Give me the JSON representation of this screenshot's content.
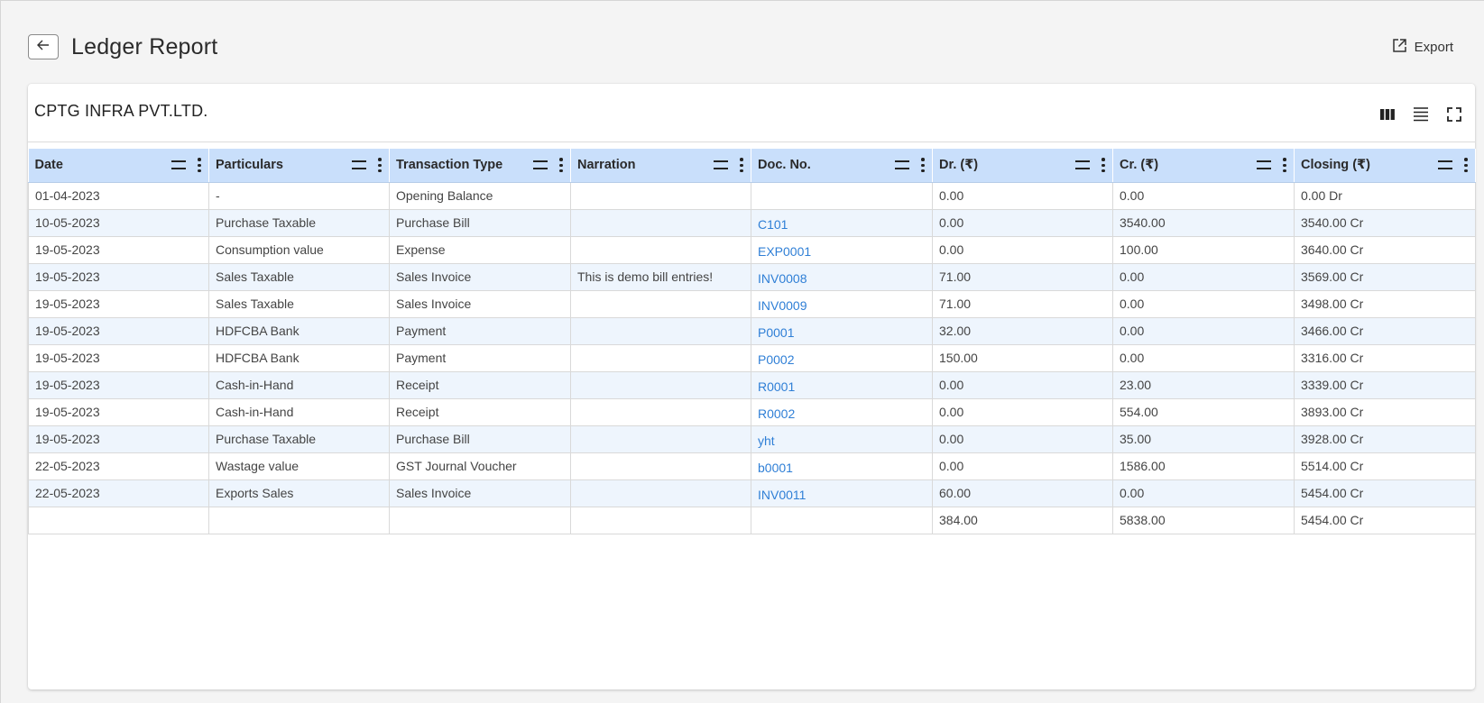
{
  "header": {
    "title": "Ledger Report",
    "back_icon": "arrow-left-icon",
    "export_label": "Export",
    "export_icon": "export-icon"
  },
  "card": {
    "company_name": "CPTG INFRA PVT.LTD.",
    "toolbar_icons": [
      "columns-icon",
      "density-icon",
      "fullscreen-icon"
    ]
  },
  "colors": {
    "header_bg": "#c9dffb",
    "alt_row_bg": "#eef5fd",
    "link": "#2f7fd6"
  },
  "table": {
    "columns": [
      "Date",
      "Particulars",
      "Transaction Type",
      "Narration",
      "Doc. No.",
      "Dr. (₹)",
      "Cr. (₹)",
      "Closing (₹)"
    ],
    "rows": [
      [
        "01-04-2023",
        "-",
        "Opening Balance",
        "",
        "",
        "0.00",
        "0.00",
        "0.00 Dr"
      ],
      [
        "10-05-2023",
        "Purchase Taxable",
        "Purchase Bill",
        "",
        "C101",
        "0.00",
        "3540.00",
        "3540.00 Cr"
      ],
      [
        "19-05-2023",
        "Consumption value",
        "Expense",
        "",
        "EXP0001",
        "0.00",
        "100.00",
        "3640.00 Cr"
      ],
      [
        "19-05-2023",
        "Sales Taxable",
        "Sales Invoice",
        "This is demo bill entries!",
        "INV0008",
        "71.00",
        "0.00",
        "3569.00 Cr"
      ],
      [
        "19-05-2023",
        "Sales Taxable",
        "Sales Invoice",
        "",
        "INV0009",
        "71.00",
        "0.00",
        "3498.00 Cr"
      ],
      [
        "19-05-2023",
        "HDFCBA Bank",
        "Payment",
        "",
        "P0001",
        "32.00",
        "0.00",
        "3466.00 Cr"
      ],
      [
        "19-05-2023",
        "HDFCBA Bank",
        "Payment",
        "",
        "P0002",
        "150.00",
        "0.00",
        "3316.00 Cr"
      ],
      [
        "19-05-2023",
        "Cash-in-Hand",
        "Receipt",
        "",
        "R0001",
        "0.00",
        "23.00",
        "3339.00 Cr"
      ],
      [
        "19-05-2023",
        "Cash-in-Hand",
        "Receipt",
        "",
        "R0002",
        "0.00",
        "554.00",
        "3893.00 Cr"
      ],
      [
        "19-05-2023",
        "Purchase Taxable",
        "Purchase Bill",
        "",
        "yht",
        "0.00",
        "35.00",
        "3928.00 Cr"
      ],
      [
        "22-05-2023",
        "Wastage value",
        "GST Journal Voucher",
        "",
        "b0001",
        "0.00",
        "1586.00",
        "5514.00 Cr"
      ],
      [
        "22-05-2023",
        "Exports Sales",
        "Sales Invoice",
        "",
        "INV0011",
        "60.00",
        "0.00",
        "5454.00 Cr"
      ]
    ],
    "totals": [
      "",
      "",
      "",
      "",
      "",
      "384.00",
      "5838.00",
      "5454.00 Cr"
    ]
  }
}
